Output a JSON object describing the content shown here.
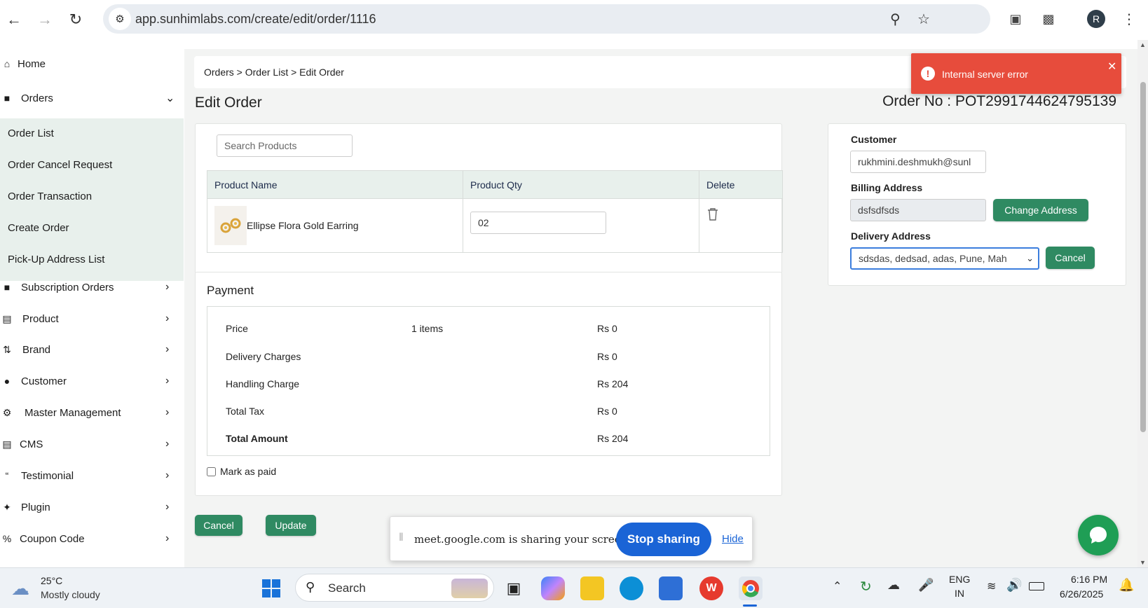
{
  "browser": {
    "url": "app.sunhimlabs.com/create/edit/order/1116",
    "profile_initial": "R"
  },
  "sidebar": {
    "items_top": [
      {
        "label": "Home",
        "icon": "home-icon"
      },
      {
        "label": "Orders",
        "icon": "bag-icon"
      }
    ],
    "orders_submenu": [
      "Order List",
      "Order Cancel Request",
      "Order Transaction",
      "Create Order",
      "Pick-Up Address List"
    ],
    "items_bottom": [
      {
        "label": "Subscription Orders",
        "icon": "bag-icon"
      },
      {
        "label": "Product",
        "icon": "box-icon"
      },
      {
        "label": "Brand",
        "icon": "shuffle-icon"
      },
      {
        "label": "Customer",
        "icon": "user-icon"
      },
      {
        "label": "Master Management",
        "icon": "user-gear-icon"
      },
      {
        "label": "CMS",
        "icon": "file-icon"
      },
      {
        "label": "Testimonial",
        "icon": "quote-icon"
      },
      {
        "label": "Plugin",
        "icon": "puzzle-icon"
      },
      {
        "label": "Coupon Code",
        "icon": "percent-icon"
      }
    ]
  },
  "page": {
    "breadcrumb": "Orders > Order List > Edit Order",
    "title": "Edit Order",
    "order_no": "Order No : POT2991744624795139"
  },
  "products": {
    "search_placeholder": "Search Products",
    "headers": [
      "Product Name",
      "Product Qty",
      "Delete"
    ],
    "rows": [
      {
        "name": "Ellipse Flora Gold Earring",
        "qty": "02"
      }
    ]
  },
  "payment": {
    "title": "Payment",
    "rows": [
      {
        "label": "Price",
        "middle": "1 items",
        "value": "Rs 0",
        "bold": false
      },
      {
        "label": "Delivery Charges",
        "middle": "",
        "value": "Rs 0",
        "bold": false
      },
      {
        "label": "Handling Charge",
        "middle": "",
        "value": "Rs 204",
        "bold": false
      },
      {
        "label": "Total Tax",
        "middle": "",
        "value": "Rs 0",
        "bold": false
      },
      {
        "label": "Total Amount",
        "middle": "",
        "value": "Rs 204",
        "bold": true
      }
    ],
    "mark_paid_label": "Mark as paid"
  },
  "actions": {
    "cancel": "Cancel",
    "update": "Update"
  },
  "customer_panel": {
    "customer_label": "Customer",
    "customer_value": "rukhmini.deshmukh@sunl",
    "billing_label": "Billing Address",
    "billing_value": "dsfsdfsds",
    "change_address": "Change Address",
    "delivery_label": "Delivery Address",
    "delivery_value": "sdsdas, dedsad, adas, Pune, Mah",
    "cancel": "Cancel"
  },
  "toast": {
    "message": "Internal server error",
    "color": "#e74c3c"
  },
  "share_bar": {
    "message": "meet.google.com is sharing your screen.",
    "stop": "Stop sharing",
    "hide": "Hide"
  },
  "taskbar": {
    "weather_temp": "25°C",
    "weather_desc": "Mostly cloudy",
    "search": "Search",
    "lang_top": "ENG",
    "lang_bottom": "IN",
    "time": "6:16 PM",
    "date": "6/26/2025"
  },
  "colors": {
    "accent": "#2f8a62",
    "submenu_bg": "#e8f0ec",
    "page_bg": "#f3f4f3"
  }
}
